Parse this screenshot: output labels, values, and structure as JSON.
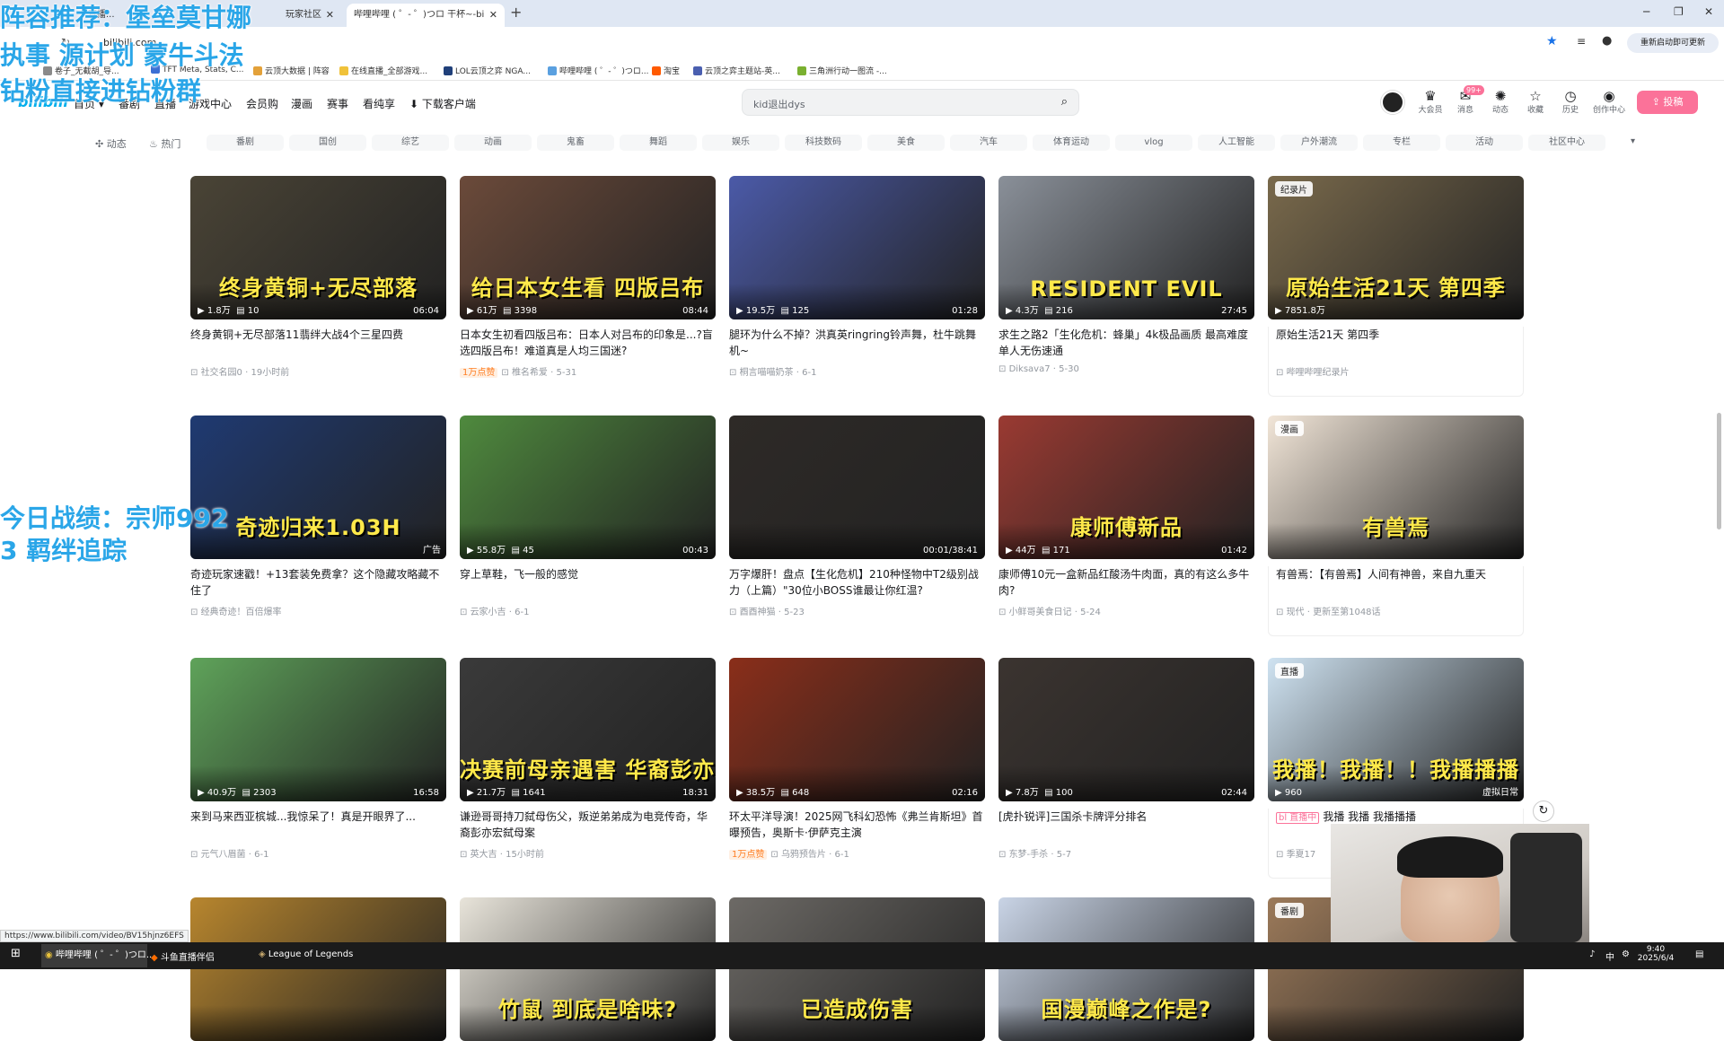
{
  "browser": {
    "tabs": [
      {
        "label": "直播..."
      },
      {
        "label": "玩家社区"
      },
      {
        "label": "哔哩哔哩 ( ゜- ゜)つロ 干杯~-bi"
      }
    ],
    "url": "bilibili.com",
    "update_button": "重新启动即可更新",
    "bookmarks": [
      "卷子_无截胡_导...",
      "TFT Meta, Stats, C...",
      "云顶大数据 | 阵容",
      "在线直播_全部游戏...",
      "LOL云顶之弈 NGA...",
      "哔哩哔哩 ( ゜- ゜)つロ...",
      "淘宝",
      "云顶之弈主题站-英...",
      "三角洲行动一图流 -..."
    ]
  },
  "overlay": {
    "line1": "阵容推荐：堡垒莫甘娜",
    "line2": "执事  源计划  蒙牛斗法",
    "line3": "钻粉直接进钻粉群",
    "line4": "今日战绩：宗师992",
    "line5": "3 羁绊追踪"
  },
  "header": {
    "logo": "bilibili",
    "nav": [
      "首页",
      "番剧",
      "直播",
      "游戏中心",
      "会员购",
      "漫画",
      "赛事",
      "看纯享",
      "下载客户端"
    ],
    "search_placeholder": "kid退出dys",
    "icons": [
      {
        "label": "大会员",
        "icon": "vip-icon"
      },
      {
        "label": "消息",
        "icon": "message-icon"
      },
      {
        "label": "动态",
        "icon": "dynamic-icon"
      },
      {
        "label": "收藏",
        "icon": "favorite-icon"
      },
      {
        "label": "历史",
        "icon": "history-icon"
      },
      {
        "label": "创作中心",
        "icon": "creator-icon"
      }
    ],
    "message_badge": "99+",
    "upload_label": "投稿"
  },
  "channels": {
    "top": [
      "动态",
      "热门"
    ],
    "items": [
      "番剧",
      "国创",
      "综艺",
      "动画",
      "鬼畜",
      "舞蹈",
      "娱乐",
      "科技数码",
      "美食",
      "汽车",
      "体育运动",
      "vlog",
      "人工智能",
      "户外潮流",
      "专栏",
      "活动",
      "社区中心"
    ]
  },
  "cards": [
    {
      "views": "1.8万",
      "comments": "10",
      "duration": "06:04",
      "overlay_text": "终身黄铜+无尽部落",
      "title": "终身黄铜+无尽部落11翡绊大战4个三星四费",
      "author": "社交名园0",
      "date": "19小时前",
      "hot": "",
      "color": "#4a4436"
    },
    {
      "views": "61万",
      "comments": "3398",
      "duration": "08:44",
      "overlay_text": "给日本女生看 四版吕布",
      "title": "日本女生初看四版吕布：日本人对吕布的印象是...?盲选四版吕布！难道真是人均三国迷?",
      "author": "椎名希爱",
      "date": "5-31",
      "hot": "1万点赞",
      "color": "#6b4a3a"
    },
    {
      "views": "19.5万",
      "comments": "125",
      "duration": "01:28",
      "overlay_text": "",
      "title": "腿环为什么不掉？洪真英ringring铃声舞，杜牛跳舞机~",
      "author": "桐言喵喵奶茶",
      "date": "6-1",
      "hot": "",
      "color": "#4b5aa8"
    },
    {
      "views": "4.3万",
      "comments": "216",
      "duration": "27:45",
      "overlay_text": "RESIDENT EVIL",
      "title": "求生之路2「生化危机：蜂巢」4k极品画质 最高难度 单人无伤速通",
      "author": "Diksava7",
      "date": "5-30",
      "hot": "",
      "color": "#8a9099"
    },
    {
      "views": "7851.8万",
      "comments": "",
      "duration": "",
      "overlay_text": "原始生活21天 第四季",
      "title": "原始生活21天 第四季",
      "author": "哔哩哔哩纪录片",
      "date": "",
      "hot": "",
      "tag": "纪录片",
      "color": "#7a6a4c"
    },
    {
      "views": "",
      "comments": "",
      "duration": "",
      "overlay_text": "奇迹归来1.03H",
      "title": "奇迹玩家速戳！+13套装免费拿？这个隐藏攻略藏不住了",
      "author": "经典奇迹！百倍爆率",
      "date": "",
      "hot": "",
      "ad": "广告",
      "color": "#1f3a72"
    },
    {
      "views": "55.8万",
      "comments": "45",
      "duration": "00:43",
      "overlay_text": "",
      "title": "穿上草鞋，飞一般的感觉",
      "author": "云家小吉",
      "date": "6-1",
      "hot": "",
      "color": "#4f8a3e"
    },
    {
      "views": "",
      "comments": "",
      "duration": "00:01/38:41",
      "overlay_text": "",
      "title": "万字爆肝！盘点【生化危机】210种怪物中T2级别战力（上篇）\"30位小BOSS谁最让你红温?",
      "author": "酉酉神猫",
      "date": "5-23",
      "hot": "",
      "color": "#2e2a27"
    },
    {
      "views": "44万",
      "comments": "171",
      "duration": "01:42",
      "overlay_text": "康师傅新品",
      "title": "康师傅10元一盒新品红酸汤牛肉面，真的有这么多牛肉?",
      "author": "小鲜哥美食日记",
      "date": "5-24",
      "hot": "",
      "color": "#9a3a32"
    },
    {
      "views": "",
      "comments": "",
      "duration": "",
      "overlay_text": "有兽焉",
      "title": "有兽焉：【有兽焉】人间有神兽，来自九重天",
      "author": "现代 · 更新至第1048话",
      "date": "",
      "hot": "",
      "tag": "漫画",
      "color": "#f2e6d8"
    },
    {
      "views": "40.9万",
      "comments": "2303",
      "duration": "16:58",
      "overlay_text": "",
      "title": "来到马来西亚槟城...我惊呆了！真是开眼界了...",
      "author": "元气八眉菌",
      "date": "6-1",
      "hot": "",
      "color": "#5fa35a"
    },
    {
      "views": "21.7万",
      "comments": "1641",
      "duration": "18:31",
      "overlay_text": "决赛前母亲遇害 华裔彭亦宏弑母案",
      "title": "谦逊哥哥持刀弑母伤父，叛逆弟弟成为电竞传奇，华裔彭亦宏弑母案",
      "author": "英大吉",
      "date": "15小时前",
      "hot": "",
      "color": "#3a3a3a"
    },
    {
      "views": "38.5万",
      "comments": "648",
      "duration": "02:16",
      "overlay_text": "",
      "title": "环太平洋导演！2025网飞科幻恐怖《弗兰肯斯坦》首曝预告，奥斯卡·伊萨克主演",
      "author": "乌鸦预告片",
      "date": "6-1",
      "hot": "1万点赞",
      "color": "#8a2e1a"
    },
    {
      "views": "7.8万",
      "comments": "100",
      "duration": "02:44",
      "overlay_text": "",
      "title": "[虎扑锐评]三国杀卡牌评分排名",
      "author": "东梦-手杀",
      "date": "5-7",
      "hot": "",
      "color": "#3b3430"
    },
    {
      "views": "960",
      "comments": "",
      "duration": "",
      "overlay_text": "我播！我播！！我播播播",
      "title": "我播 我播 我播播播",
      "author": "季夏17",
      "date": "",
      "hot": "",
      "tag": "直播",
      "live": "bl 直播中",
      "live_area": "虚拟日常",
      "color": "#cfe3f2"
    },
    {
      "views": "",
      "comments": "",
      "duration": "",
      "overlay_text": "",
      "title": "",
      "author": "",
      "date": "",
      "hot": "",
      "color": "#b8862e"
    },
    {
      "views": "",
      "comments": "",
      "duration": "",
      "overlay_text": "竹鼠 到底是啥味?",
      "title": "",
      "author": "",
      "date": "",
      "hot": "",
      "color": "#e8e4da"
    },
    {
      "views": "",
      "comments": "",
      "duration": "",
      "overlay_text": "已造成伤害",
      "title": "",
      "author": "",
      "date": "",
      "hot": "",
      "color": "#6d6a66"
    },
    {
      "views": "",
      "comments": "",
      "duration": "",
      "overlay_text": "国漫巅峰之作是?",
      "title": "",
      "author": "",
      "date": "",
      "hot": "",
      "color": "#c9d4e6"
    },
    {
      "views": "",
      "comments": "",
      "duration": "",
      "overlay_text": "",
      "title": "",
      "author": "",
      "date": "",
      "hot": "",
      "tag": "番剧",
      "color": "#9c7a5a"
    }
  ],
  "status_url": "https://www.bilibili.com/video/BV15hjnz6EFS",
  "taskbar": {
    "items": [
      "哔哩哔哩 ( ゜- ゜)つロ...",
      "斗鱼直播伴侣",
      "League of Legends"
    ],
    "ime": "中",
    "time": "9:40",
    "date": "2025/6/4"
  }
}
